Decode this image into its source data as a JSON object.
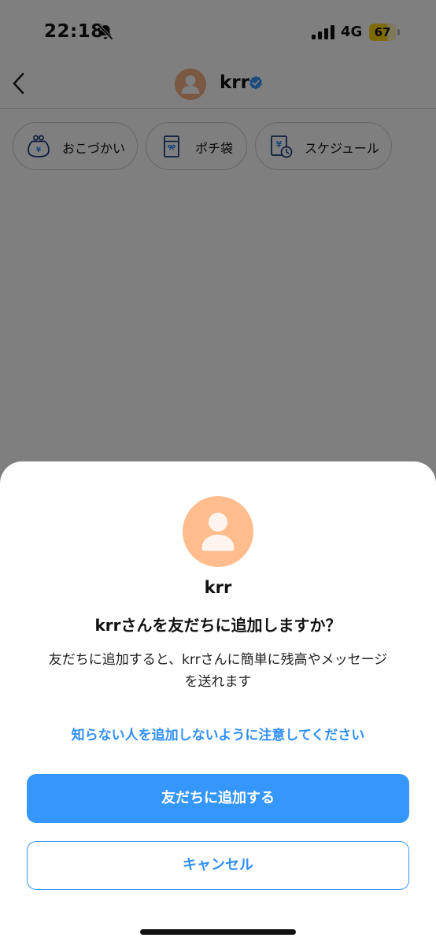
{
  "status_bar": {
    "time": "22:18",
    "network": "4G",
    "battery_level": "67",
    "battery_fraction": 0.67
  },
  "header": {
    "name": "krr",
    "icons": [
      "back-icon",
      "avatar",
      "verified-badge-icon"
    ]
  },
  "quick_actions": [
    {
      "label": "おこづかい",
      "icon": "wallet-yen-icon"
    },
    {
      "label": "ポチ袋",
      "icon": "gift-envelope-icon"
    },
    {
      "label": "スケジュール",
      "icon": "yen-calendar-clock-icon"
    }
  ],
  "dialog": {
    "name": "krr",
    "title": "krrさんを友だちに追加しますか？",
    "description_line1": "友だちに追加すると、krrさんに簡単に残高やメッセージ",
    "description_line2": "を送れます",
    "warning": "知らない人を追加しないように注意してください",
    "primary_button": "友だちに追加する",
    "secondary_button": "キャンセル"
  },
  "colors": {
    "accent": "#3597fb",
    "avatar": "#ffbd8e",
    "battery": "#ffd60a"
  }
}
